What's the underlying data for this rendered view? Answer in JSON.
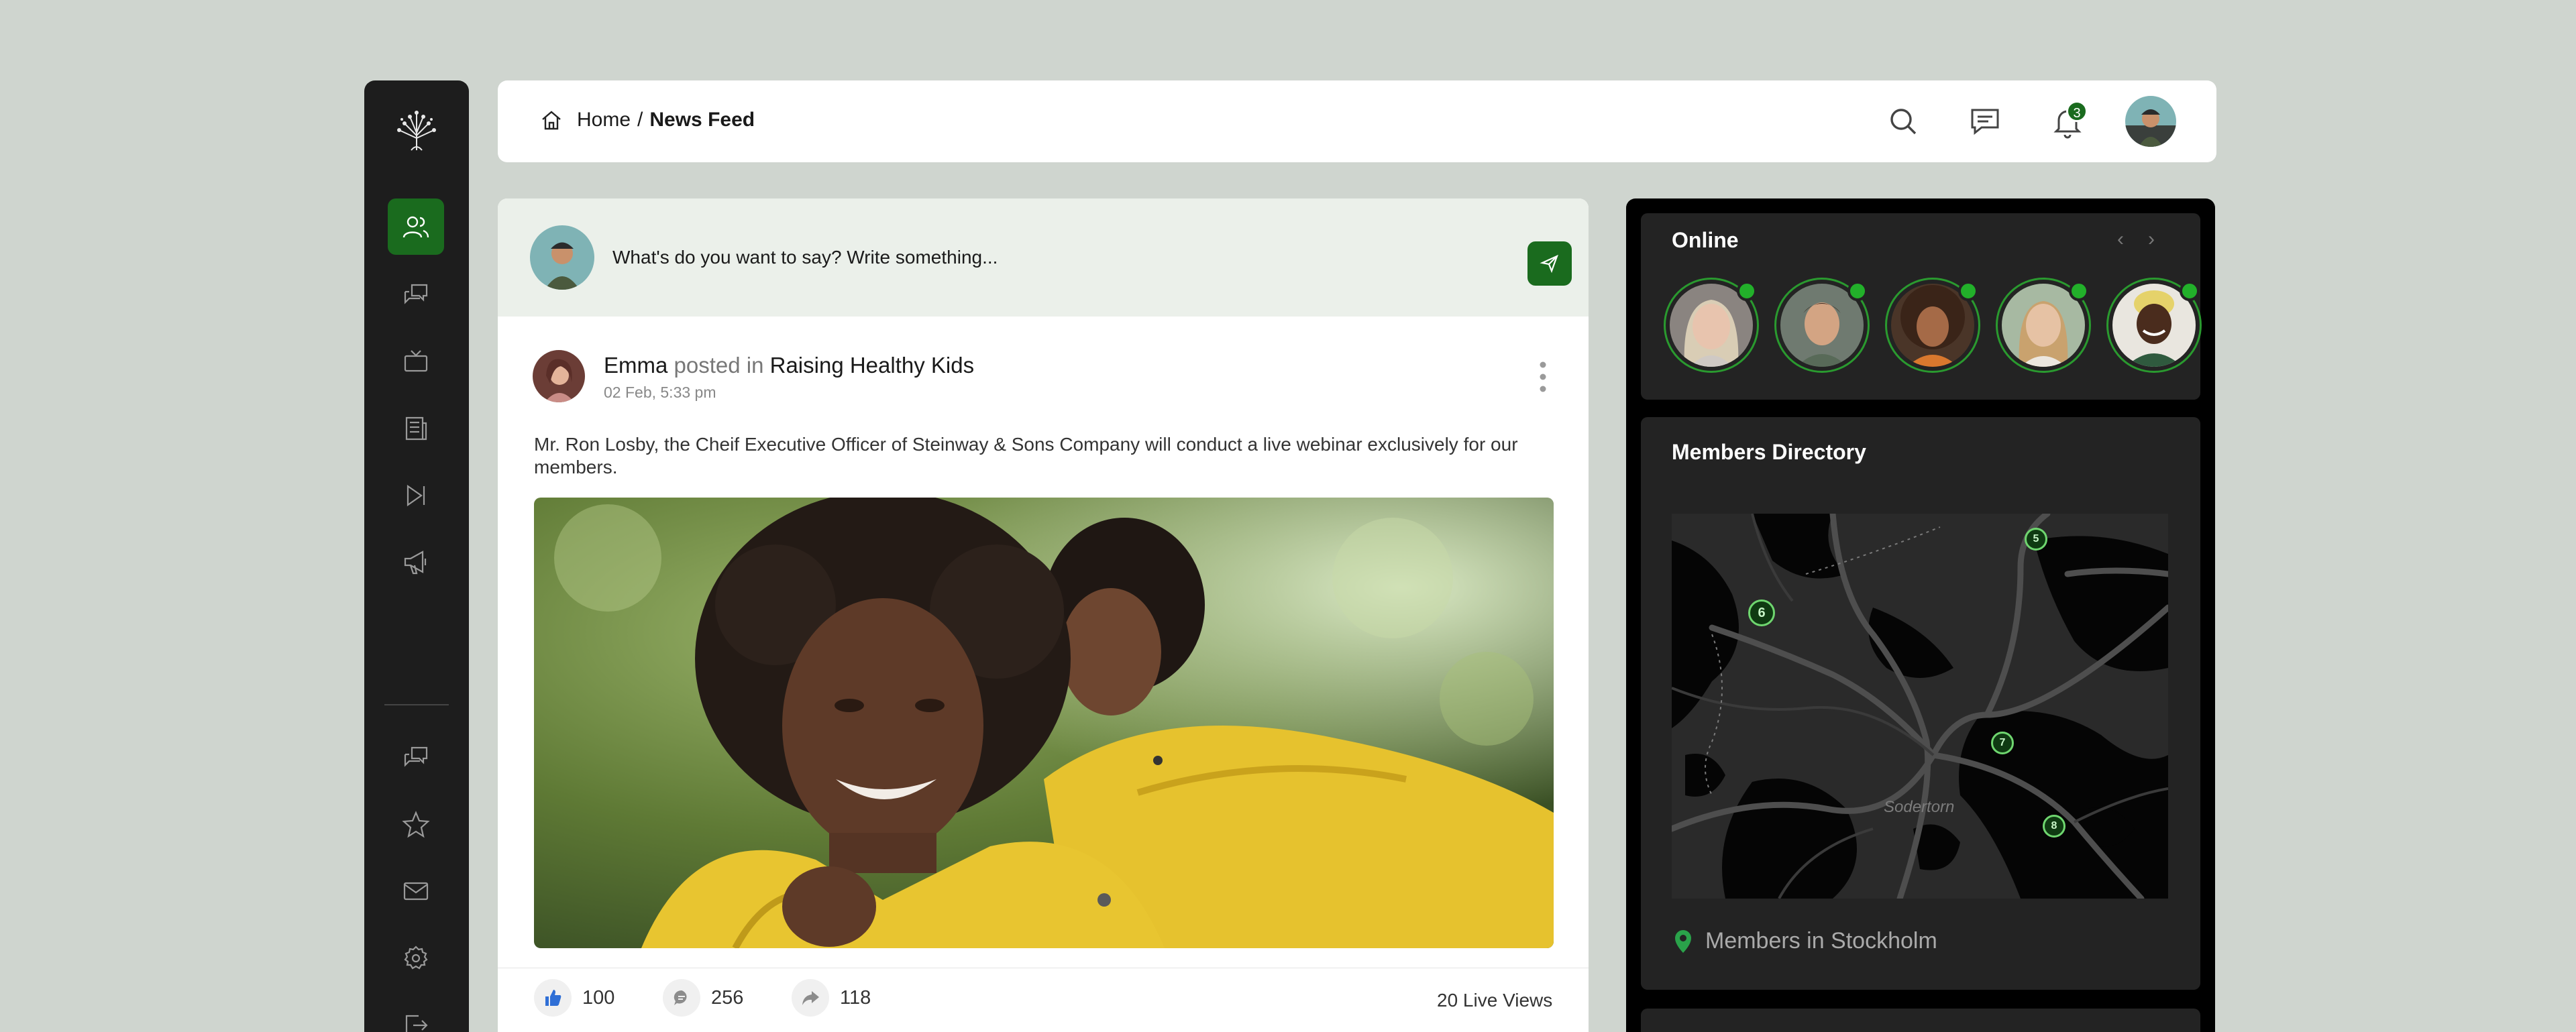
{
  "breadcrumb": {
    "home": "Home",
    "separator": "/",
    "current": "News Feed"
  },
  "header": {
    "notification_count": "3"
  },
  "composer": {
    "placeholder": "What's do you want to say? Write something..."
  },
  "post": {
    "author": "Emma",
    "connector": "posted in",
    "group": "Raising Healthy Kids",
    "date": "02 Feb, 5:33 pm",
    "text": "Mr. Ron Losby, the Cheif Executive Officer of Steinway & Sons Company will conduct a live webinar exclusively for our members.",
    "likes": "100",
    "comments": "256",
    "shares": "118",
    "views": "20 Live Views"
  },
  "online": {
    "title": "Online",
    "prev": "‹",
    "next": "›"
  },
  "directory": {
    "title": "Members Directory",
    "map_place": "Sodertorn",
    "pins": [
      "6",
      "5",
      "7",
      "8"
    ],
    "location_text": "Members in Stockholm"
  },
  "sidebar": {
    "items": [
      "community-icon",
      "forum-icon",
      "tv-icon",
      "news-icon",
      "skip-icon",
      "megaphone-icon",
      "chat-icon",
      "star-icon",
      "mail-icon",
      "settings-icon",
      "logout-icon"
    ]
  },
  "colors": {
    "accent": "#1a6b1e",
    "online": "#22b02a",
    "page_bg": "#cfd5cf",
    "sidebar_bg": "#1d1d1d"
  }
}
